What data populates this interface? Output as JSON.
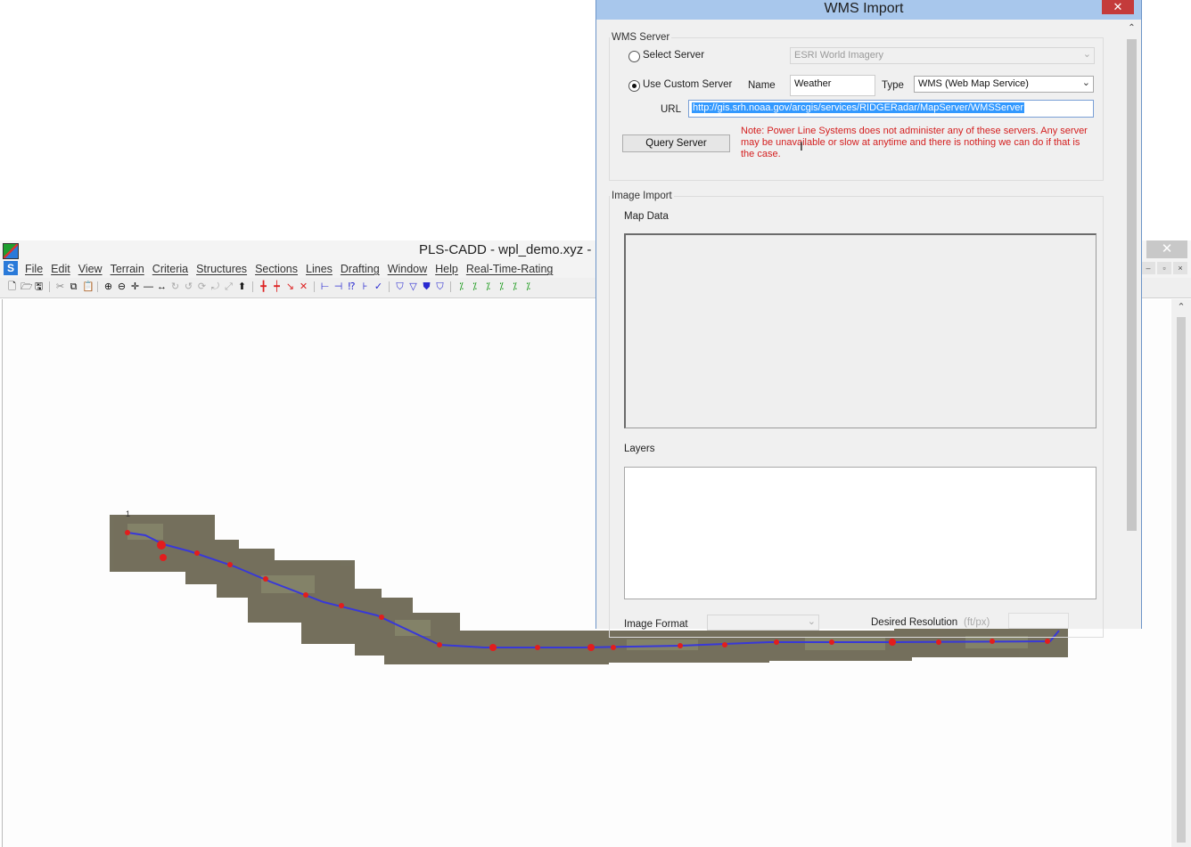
{
  "app": {
    "title": "PLS-CADD - wpl_demo.xyz -",
    "menu": [
      "File",
      "Edit",
      "View",
      "Terrain",
      "Criteria",
      "Structures",
      "Sections",
      "Lines",
      "Drafting",
      "Window",
      "Help",
      "Real-Time-Rating"
    ],
    "close_glyph": "✕",
    "mdi_controls": [
      "–",
      "▫",
      "×"
    ]
  },
  "map": {
    "imagery_color": "#6e6a5a",
    "line_color": "#3a3ad6",
    "structure_color": "#e21d1d",
    "start_label": "1"
  },
  "dialog": {
    "title": "WMS Import",
    "close_glyph": "✕",
    "wms_server": {
      "legend": "WMS Server",
      "select_server_label": "Select Server",
      "select_server_value": "ESRI World Imagery",
      "use_custom_label": "Use Custom Server",
      "name_label": "Name",
      "name_value": "Weather",
      "type_label": "Type",
      "type_value": "WMS (Web Map Service)",
      "url_label": "URL",
      "url_value": "http://gis.srh.noaa.gov/arcgis/services/RIDGERadar/MapServer/WMSServer",
      "query_button": "Query Server",
      "note": "Note: Power Line Systems does not administer any of these servers.  Any server may be unavailable or slow at anytime and there is nothing we can do if that is the case."
    },
    "image_import": {
      "legend": "Image Import",
      "map_data_label": "Map Data",
      "layers_label": "Layers",
      "image_format_label": "Image Format",
      "desired_resolution_label": "Desired Resolution",
      "resolution_unit": "(ft/px)"
    }
  }
}
